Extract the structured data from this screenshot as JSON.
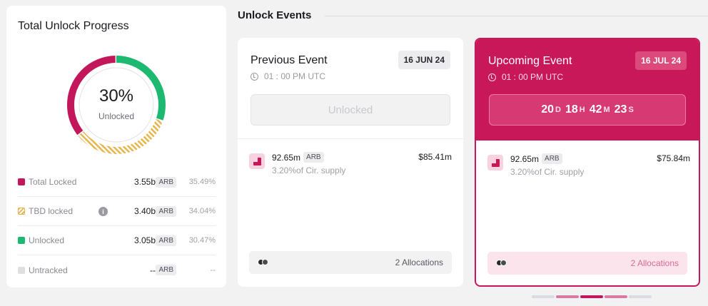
{
  "progress": {
    "title": "Total Unlock Progress",
    "percent_label": "30%",
    "center_label": "Unlocked",
    "segments": [
      {
        "name": "Total Locked",
        "fraction": 0.3549,
        "color": "#c2185b"
      },
      {
        "name": "TBD locked",
        "fraction": 0.3404,
        "color": "#e6b54d"
      },
      {
        "name": "Unlocked",
        "fraction": 0.3047,
        "color": "#1db971"
      }
    ],
    "rows": [
      {
        "label": "Total Locked",
        "value": "3.55b",
        "token": "ARB",
        "pct": "35.49%"
      },
      {
        "label": "TBD locked",
        "value": "3.40b",
        "token": "ARB",
        "pct": "34.04%",
        "info": "i"
      },
      {
        "label": "Unlocked",
        "value": "3.05b",
        "token": "ARB",
        "pct": "30.47%"
      },
      {
        "label": "Untracked",
        "value": "--",
        "token": "ARB",
        "pct": "--"
      }
    ]
  },
  "events": {
    "title": "Unlock Events",
    "previous": {
      "name": "Previous Event",
      "date": "16 JUN 24",
      "time": "01 : 00 PM UTC",
      "button": "Unlocked",
      "amount": "92.65m",
      "token": "ARB",
      "supply": "3.20%of Cir. supply",
      "usd": "$85.41m",
      "allocations": "2 Allocations"
    },
    "upcoming": {
      "name": "Upcoming Event",
      "date": "16 JUL 24",
      "time": "01 : 00 PM UTC",
      "countdown": {
        "d": "20",
        "d_unit": "D",
        "h": "18",
        "h_unit": "H",
        "m": "42",
        "m_unit": "M",
        "s": "23",
        "s_unit": "S"
      },
      "amount": "92.65m",
      "token": "ARB",
      "supply": "3.20%of Cir. supply",
      "usd": "$75.84m",
      "allocations": "2 Allocations"
    }
  },
  "pager": {
    "colors": [
      "#dcdce0",
      "#d97aa0",
      "#c2185b",
      "#d97aa0",
      "#dcdce0"
    ],
    "active_index": 2
  },
  "colors": {
    "accent": "#c8185a",
    "unlocked": "#1db971",
    "tbd": "#e6b54d"
  }
}
